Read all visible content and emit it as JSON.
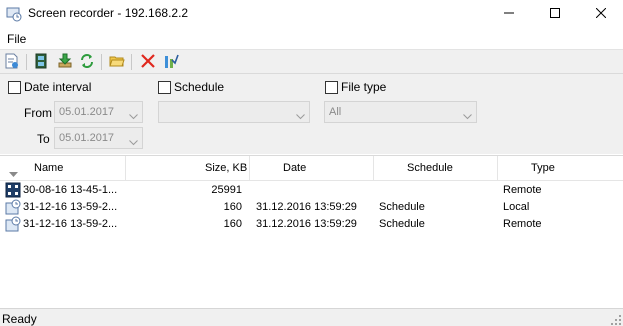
{
  "window": {
    "title": "Screen recorder - 192.168.2.2",
    "icon": "screen-recorder-icon",
    "controls": [
      "minimize-icon",
      "maximize-icon",
      "close-icon"
    ]
  },
  "menu": {
    "file": "File"
  },
  "toolbar": {
    "buttons": [
      "properties-icon",
      "play-video-icon",
      "download-icon",
      "refresh-icon",
      "open-folder-icon",
      "delete-icon",
      "convert-icon"
    ]
  },
  "filters": {
    "date_interval": {
      "label": "Date interval",
      "checked": false
    },
    "from_label": "From",
    "from_value": "05.01.2017",
    "to_label": "To",
    "to_value": "05.01.2017",
    "schedule": {
      "label": "Schedule",
      "checked": false,
      "value": ""
    },
    "file_type": {
      "label": "File type",
      "checked": false,
      "value": "All"
    }
  },
  "list": {
    "columns": [
      "Name",
      "Size, KB",
      "Date",
      "Schedule",
      "Type"
    ],
    "rows": [
      {
        "icon": "video-file-icon",
        "name": "30-08-16 13-45-1...",
        "size": "25991",
        "date": "",
        "schedule": "",
        "type": "Remote"
      },
      {
        "icon": "scheduled-file-icon",
        "name": "31-12-16 13-59-2...",
        "size": "160",
        "date": "31.12.2016 13:59:29",
        "schedule": "Schedule",
        "type": "Local"
      },
      {
        "icon": "scheduled-file-icon",
        "name": "31-12-16 13-59-2...",
        "size": "160",
        "date": "31.12.2016 13:59:29",
        "schedule": "Schedule",
        "type": "Remote"
      }
    ]
  },
  "status": {
    "text": "Ready"
  }
}
